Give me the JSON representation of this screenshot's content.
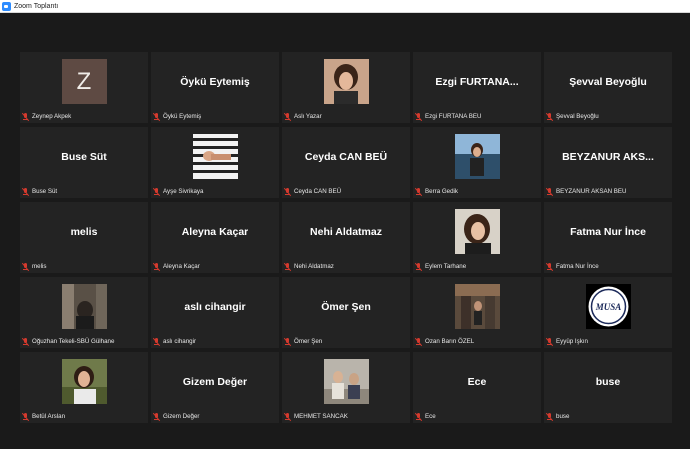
{
  "window": {
    "title": "Zoom Toplantı",
    "icon": "zoom-logo-icon"
  },
  "colors": {
    "background": "#1a1a1a",
    "tile": "#232323",
    "muted_mic": "#d53a2e",
    "zoom_blue": "#2d8cff"
  },
  "participants": [
    {
      "display": "Z",
      "name": "Zeynep Akpek",
      "mode": "letter"
    },
    {
      "display": "Öykü Eytemiş",
      "name": "Öykü Eytemiş",
      "mode": "name"
    },
    {
      "display": "",
      "name": "Aslı Yazar",
      "mode": "video"
    },
    {
      "display": "Ezgi  FURTANA...",
      "name": "Ezgi FURTANA BEU",
      "mode": "name"
    },
    {
      "display": "Şevval Beyoğlu",
      "name": "Şevval Beyoğlu",
      "mode": "name"
    },
    {
      "display": "Buse Süt",
      "name": "Buse Süt",
      "mode": "name"
    },
    {
      "display": "",
      "name": "Ayşe Sivrikaya",
      "mode": "video"
    },
    {
      "display": "Ceyda CAN BEÜ",
      "name": "Ceyda CAN BEÜ",
      "mode": "name"
    },
    {
      "display": "",
      "name": "Berra Gedik",
      "mode": "video"
    },
    {
      "display": "BEYZANUR  AKS...",
      "name": "BEYZANUR AKSAN BEU",
      "mode": "name"
    },
    {
      "display": "melis",
      "name": "melis",
      "mode": "name"
    },
    {
      "display": "Aleyna Kaçar",
      "name": "Aleyna Kaçar",
      "mode": "name"
    },
    {
      "display": "Nehi Aldatmaz",
      "name": "Nehi Aldatmaz",
      "mode": "name"
    },
    {
      "display": "",
      "name": "Eylem Tarhane",
      "mode": "video"
    },
    {
      "display": "Fatma Nur İnce",
      "name": "Fatma Nur İnce",
      "mode": "name"
    },
    {
      "display": "",
      "name": "Oğuzhan Tekeli-SBÜ Gülhane",
      "mode": "video"
    },
    {
      "display": "aslı cihangir",
      "name": "aslı cihangir",
      "mode": "name"
    },
    {
      "display": "Ömer Şen",
      "name": "Ömer Şen",
      "mode": "name"
    },
    {
      "display": "",
      "name": "Ozan Barın ÖZEL",
      "mode": "video"
    },
    {
      "display": "",
      "name": "Eyyüp Işkın",
      "mode": "video",
      "logo_text": "MUSA"
    },
    {
      "display": "",
      "name": "Betül Arslan",
      "mode": "video"
    },
    {
      "display": "Gizem Değer",
      "name": "Gizem Değer",
      "mode": "name"
    },
    {
      "display": "",
      "name": "MEHMET SANCAK",
      "mode": "video"
    },
    {
      "display": "Ece",
      "name": "Ece",
      "mode": "name"
    },
    {
      "display": "buse",
      "name": "buse",
      "mode": "name"
    }
  ]
}
